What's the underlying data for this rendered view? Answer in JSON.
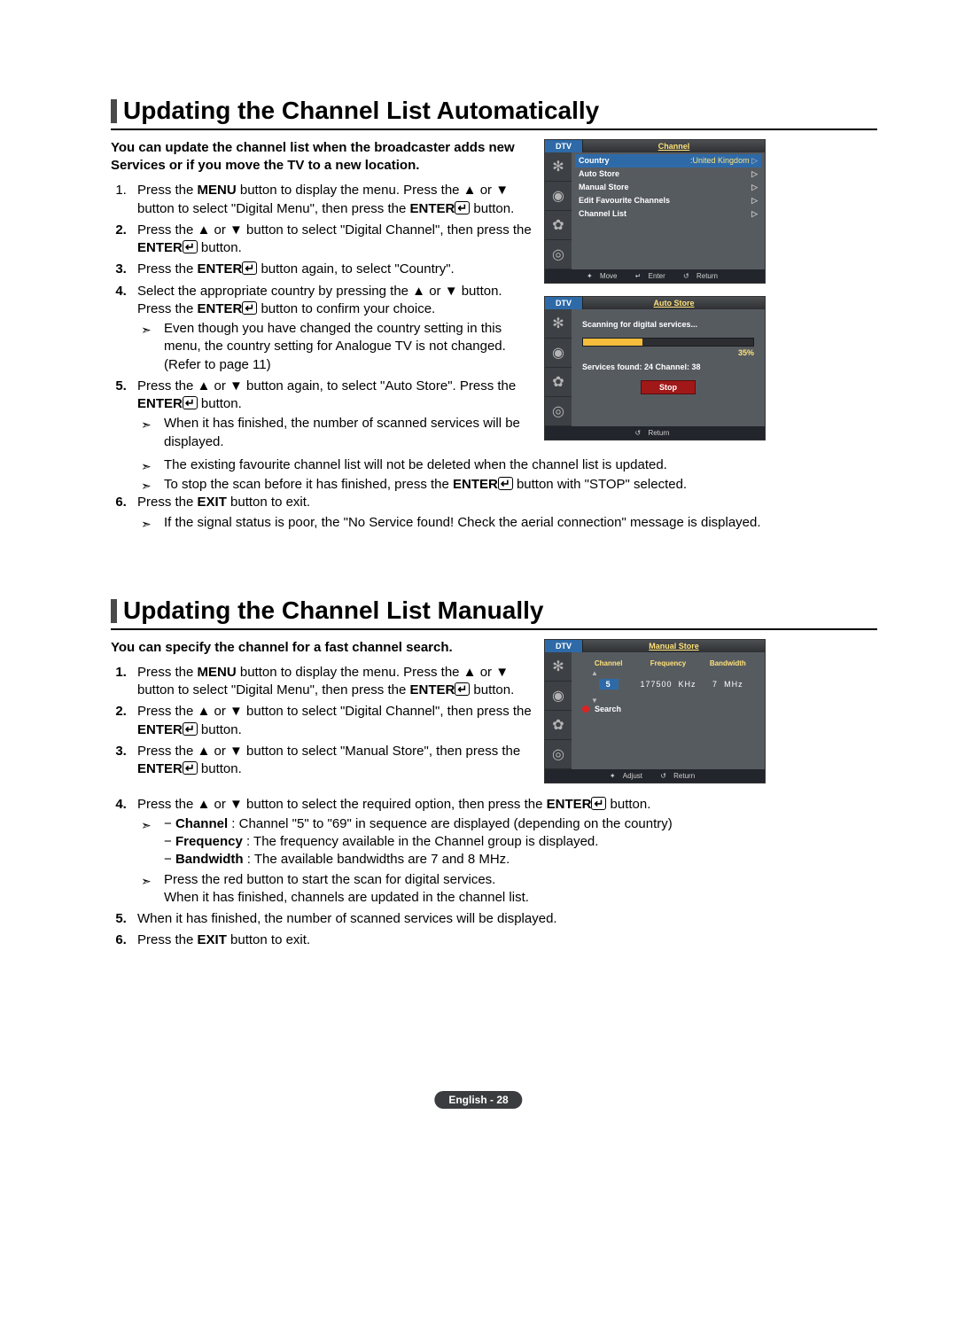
{
  "section1": {
    "title": "Updating the Channel List Automatically",
    "lead": "You can update the channel list when the broadcaster adds new Services or if you move the TV to a new location.",
    "steps": [
      {
        "num": "1",
        "bold": false,
        "text": "Press the {MENU} button to display the menu. Press the ▲ or ▼ button to select \"Digital Menu\", then press the {ENTER}{EI} button."
      },
      {
        "num": "2",
        "bold": true,
        "text": "Press the ▲ or ▼ button to select \"Digital Channel\", then press the {ENTER}{EI} button."
      },
      {
        "num": "3",
        "bold": true,
        "text": "Press the {ENTER}{EI} button again, to select \"Country\"."
      },
      {
        "num": "4",
        "bold": true,
        "text": "Select the appropriate country by pressing the ▲ or ▼ button. Press the {ENTER}{EI} button to confirm your choice.",
        "notes": [
          "Even though you have changed the country setting in this menu, the country setting for Analogue TV is not changed. (Refer to page 11)"
        ]
      },
      {
        "num": "5",
        "bold": true,
        "text": "Press the ▲ or ▼ button again, to select \"Auto Store\". Press the {ENTER}{EI} button.",
        "notes": [
          "When it has finished, the number of scanned services will be displayed.",
          "The existing favourite channel list will not be deleted when the channel list is updated.",
          "To stop the scan before it has finished, press the {ENTER}{EI} button with \"STOP\" selected."
        ]
      },
      {
        "num": "6",
        "bold": true,
        "text": "Press the {EXIT} button to exit.",
        "notes": [
          "If the signal status is poor, the \"No Service found! Check the aerial connection\" message is displayed."
        ]
      }
    ]
  },
  "section2": {
    "title": "Updating the Channel List Manually",
    "lead": "You can specify the channel for a fast channel search.",
    "steps": [
      {
        "num": "1",
        "bold": true,
        "text": "Press the {MENU} button to display the menu. Press the ▲ or ▼ button to select \"Digital Menu\", then press the {ENTER}{EI} button."
      },
      {
        "num": "2",
        "bold": true,
        "text": "Press the ▲ or ▼ button to select \"Digital Channel\", then press the {ENTER}{EI} button."
      },
      {
        "num": "3",
        "bold": true,
        "text": "Press the ▲ or ▼ button to select \"Manual Store\", then press the {ENTER}{EI} button."
      },
      {
        "num": "4",
        "bold": true,
        "text": "Press the ▲ or ▼ button to select  the required option,  then press the {ENTER}{EI} button.",
        "notes": [
          "− {Channel} : Channel \"5\" to \"69\" in sequence are displayed (depending on the country)\n− {Frequency} : The frequency available in the Channel group is displayed.\n− {Bandwidth} : The available bandwidths are 7 and 8 MHz.",
          "Press the red button to start the scan for digital services.\nWhen it has finished, channels are updated in the channel list."
        ]
      },
      {
        "num": "5",
        "bold": true,
        "text": "When it has finished, the number of scanned services will be displayed."
      },
      {
        "num": "6",
        "bold": true,
        "text": "Press the {EXIT} button to exit."
      }
    ]
  },
  "osd1": {
    "dtv": "DTV",
    "tab": "Channel",
    "rows": [
      {
        "label": "Country",
        "val": ":United Kingdom",
        "sel": true,
        "arrow": true
      },
      {
        "label": "Auto Store",
        "arrow": true
      },
      {
        "label": "Manual Store",
        "arrow": true
      },
      {
        "label": "Edit Favourite Channels",
        "arrow": true
      },
      {
        "label": "Channel List",
        "arrow": true
      }
    ],
    "footer": {
      "move": "Move",
      "enter": "Enter",
      "ret": "Return"
    }
  },
  "osd2": {
    "dtv": "DTV",
    "tab": "Auto Store",
    "scan": "Scanning for digital services...",
    "pct": "35%",
    "found": "Services found: 24    Channel: 38",
    "stop": "Stop",
    "footer": {
      "ret": "Return"
    }
  },
  "osd3": {
    "dtv": "DTV",
    "tab": "Manual Store",
    "cols": {
      "c1": "Channel",
      "c2": "Frequency",
      "c3": "Bandwidth"
    },
    "vals": {
      "ch": "5",
      "freq": "177500",
      "fu": "KHz",
      "bw": "7",
      "bu": "MHz"
    },
    "search": "Search",
    "footer": {
      "adj": "Adjust",
      "ret": "Return"
    }
  },
  "pagenum": "English - 28",
  "icons": {
    "up": "▲",
    "down": "▼",
    "arrow": "▷",
    "move": "✦",
    "enter": "↵",
    "ret": "↺",
    "ptr": "➣"
  }
}
